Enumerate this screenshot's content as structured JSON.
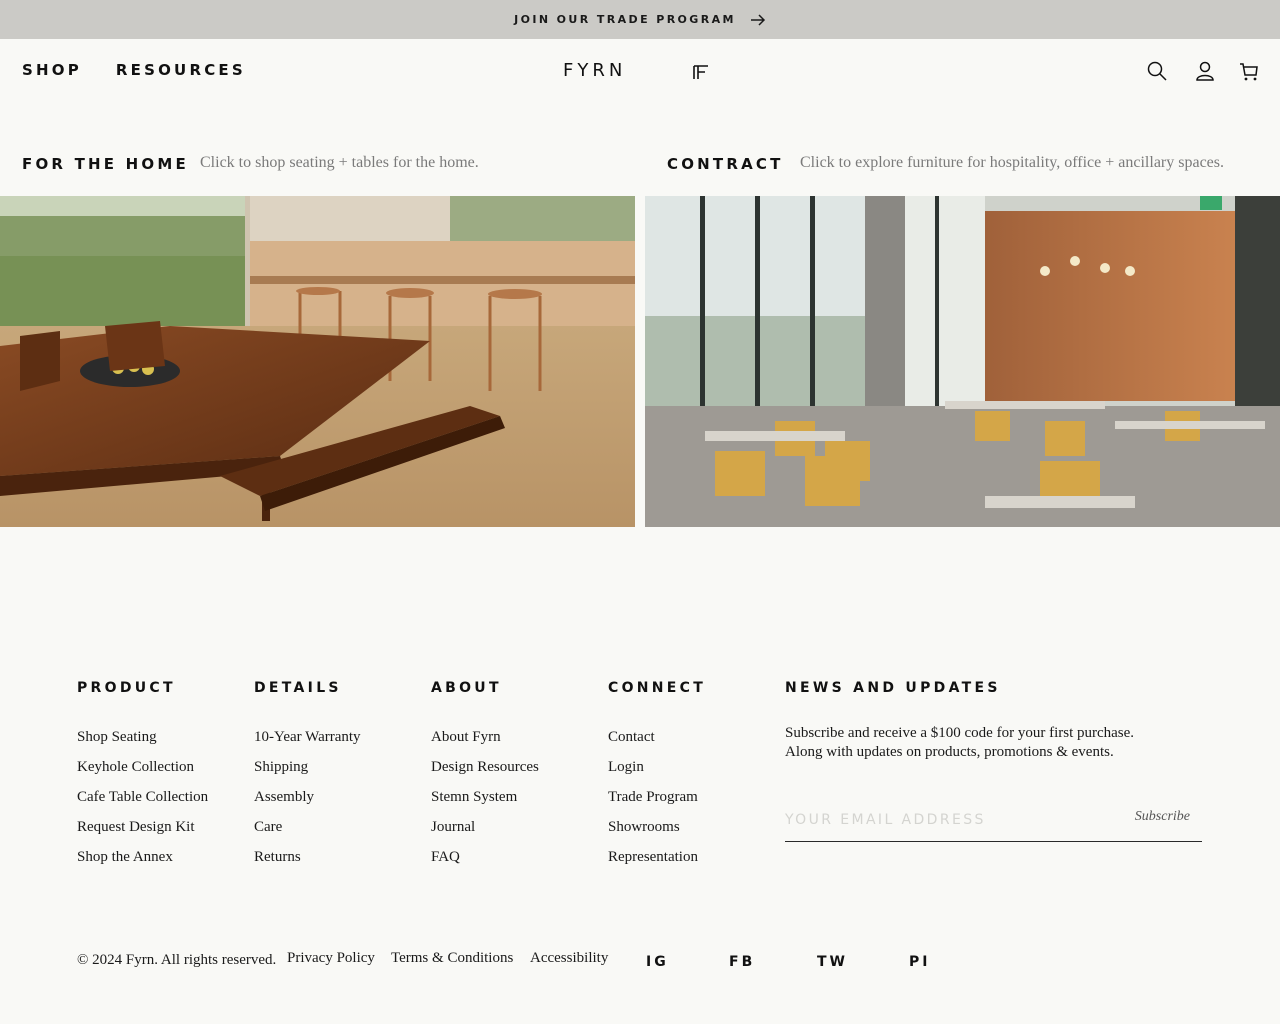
{
  "banner": {
    "text": "JOIN OUR TRADE PROGRAM",
    "icon": "arrow-right-icon"
  },
  "header": {
    "nav": [
      "SHOP",
      "RESOURCES"
    ],
    "logo": "FYRN",
    "icons": [
      "search-icon",
      "account-icon",
      "cart-icon"
    ]
  },
  "sections": {
    "home": {
      "heading": "FOR THE HOME",
      "description": "Click to shop seating + tables for the home."
    },
    "contract": {
      "heading": "CONTRACT",
      "description": "Click to explore furniture for hospitality, office + ancillary spaces."
    }
  },
  "footer": {
    "columns": [
      {
        "heading": "PRODUCT",
        "links": [
          "Shop Seating",
          "Keyhole Collection",
          "Cafe Table Collection",
          "Request Design Kit",
          "Shop the Annex"
        ]
      },
      {
        "heading": "DETAILS",
        "links": [
          "10-Year Warranty",
          "Shipping",
          "Assembly",
          "Care",
          "Returns"
        ]
      },
      {
        "heading": "ABOUT",
        "links": [
          "About Fyrn",
          "Design Resources",
          "Stemn System",
          "Journal",
          "FAQ"
        ]
      },
      {
        "heading": "CONNECT",
        "links": [
          "Contact",
          "Login",
          "Trade Program",
          "Showrooms",
          "Representation"
        ]
      }
    ],
    "news": {
      "heading": "NEWS AND UPDATES",
      "line1": "Subscribe and receive a $100 code for your first purchase.",
      "line2": "Along with updates on products, promotions & events.",
      "email_placeholder": "YOUR EMAIL ADDRESS",
      "subscribe": "Subscribe"
    },
    "copyright": "© 2024 Fyrn. All rights reserved.",
    "legal": [
      "Privacy Policy",
      "Terms & Conditions",
      "Accessibility"
    ],
    "social": [
      "IG",
      "FB",
      "TW",
      "PI"
    ]
  },
  "colors": {
    "banner_bg": "#cbcac6",
    "page_bg": "#f9f9f6",
    "muted_text": "#7a7a7a"
  }
}
